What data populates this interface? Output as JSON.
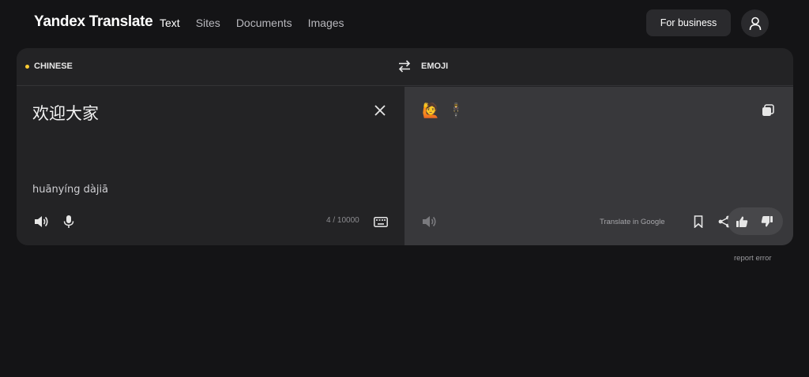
{
  "header": {
    "logo": "Yandex Translate",
    "nav": [
      "Text",
      "Sites",
      "Documents",
      "Images"
    ],
    "active_nav": "Text",
    "business_button": "For business"
  },
  "languages": {
    "source": "CHINESE",
    "target": "EMOJI"
  },
  "source": {
    "text": "欢迎大家",
    "transliteration": "huānyíng dàjiā",
    "counter": "4 / 10000"
  },
  "target": {
    "emojis": [
      "🙋",
      "🕴"
    ],
    "google_link": "Translate in Google"
  },
  "footer": {
    "report_error": "report error"
  },
  "colors": {
    "background": "#141416",
    "panel": "#232325",
    "target_pane": "#38383b",
    "accent_dot": "#ffcc33"
  }
}
